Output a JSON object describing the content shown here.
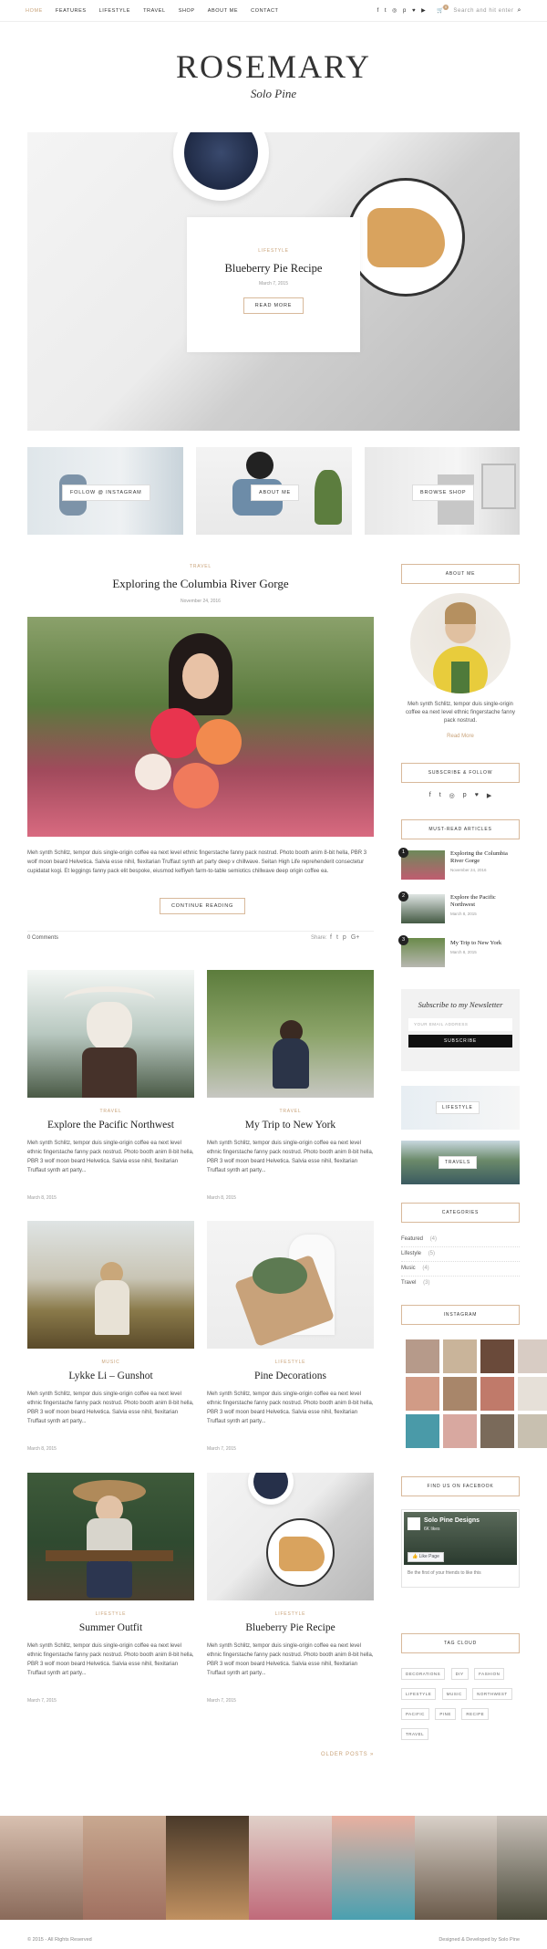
{
  "nav": {
    "items": [
      "HOME",
      "FEATURES",
      "LIFESTYLE",
      "TRAVEL",
      "SHOP",
      "ABOUT ME",
      "CONTACT"
    ],
    "search_placeholder": "Search and hit enter",
    "cart_count": "0"
  },
  "brand": {
    "title": "ROSEMARY",
    "subtitle": "Solo Pine"
  },
  "hero": {
    "category": "LIFESTYLE",
    "title": "Blueberry Pie Recipe",
    "date": "March 7, 2015",
    "button": "READ MORE"
  },
  "promos": [
    "FOLLOW @ INSTAGRAM",
    "ABOUT ME",
    "BROWSE SHOP"
  ],
  "featured": {
    "category": "TRAVEL",
    "title": "Exploring the Columbia River Gorge",
    "date": "November 24, 2016",
    "excerpt": "Meh synth Schlitz, tempor duis single-origin coffee ea next level ethnic fingerstache fanny pack nostrud. Photo booth anim 8-bit hella, PBR 3 wolf moon beard Helvetica. Salvia esse nihil, flexitarian Truffaut synth art party deep v chillwave. Seitan High Life reprehenderit consectetur cupidatat kogi. Et leggings fanny pack elit bespoke, eiusmod keffiyeh farm-to-table semiotics chillwave deep origin coffee ea.",
    "button": "CONTINUE READING",
    "comments": "0 Comments",
    "share": "Share:"
  },
  "grid_posts": [
    {
      "category": "TRAVEL",
      "title": "Explore the Pacific Northwest",
      "excerpt": "Meh synth Schlitz, tempor duis single-origin coffee ea next level ethnic fingerstache fanny pack nostrud. Photo booth anim 8-bit hella, PBR 3 wolf moon beard Helvetica. Salvia esse nihil, flexitarian Truffaut synth art party...",
      "date": "March 8, 2015"
    },
    {
      "category": "TRAVEL",
      "title": "My Trip to New York",
      "excerpt": "Meh synth Schlitz, tempor duis single-origin coffee ea next level ethnic fingerstache fanny pack nostrud. Photo booth anim 8-bit hella, PBR 3 wolf moon beard Helvetica. Salvia esse nihil, flexitarian Truffaut synth art party...",
      "date": "March 8, 2015"
    },
    {
      "category": "MUSIC",
      "title": "Lykke Li – Gunshot",
      "excerpt": "Meh synth Schlitz, tempor duis single-origin coffee ea next level ethnic fingerstache fanny pack nostrud. Photo booth anim 8-bit hella, PBR 3 wolf moon beard Helvetica. Salvia esse nihil, flexitarian Truffaut synth art party...",
      "date": "March 8, 2015"
    },
    {
      "category": "LIFESTYLE",
      "title": "Pine Decorations",
      "excerpt": "Meh synth Schlitz, tempor duis single-origin coffee ea next level ethnic fingerstache fanny pack nostrud. Photo booth anim 8-bit hella, PBR 3 wolf moon beard Helvetica. Salvia esse nihil, flexitarian Truffaut synth art party...",
      "date": "March 7, 2015"
    },
    {
      "category": "LIFESTYLE",
      "title": "Summer Outfit",
      "excerpt": "Meh synth Schlitz, tempor duis single-origin coffee ea next level ethnic fingerstache fanny pack nostrud. Photo booth anim 8-bit hella, PBR 3 wolf moon beard Helvetica. Salvia esse nihil, flexitarian Truffaut synth art party...",
      "date": "March 7, 2015"
    },
    {
      "category": "LIFESTYLE",
      "title": "Blueberry Pie Recipe",
      "excerpt": "Meh synth Schlitz, tempor duis single-origin coffee ea next level ethnic fingerstache fanny pack nostrud. Photo booth anim 8-bit hella, PBR 3 wolf moon beard Helvetica. Salvia esse nihil, flexitarian Truffaut synth art party...",
      "date": "March 7, 2015"
    }
  ],
  "older_posts": "OLDER POSTS »",
  "sidebar": {
    "about_title": "ABOUT ME",
    "about_text": "Meh synth Schlitz, tempor duis single-origin coffee ea next level ethnic fingerstache fanny pack nostrud.",
    "read_more": "Read More",
    "subscribe_title": "SUBSCRIBE & FOLLOW",
    "mustread_title": "MUST-READ ARTICLES",
    "mustread": [
      {
        "num": "1",
        "title": "Exploring the Columbia River Gorge",
        "date": "November 24, 2016"
      },
      {
        "num": "2",
        "title": "Explore the Pacific Northwest",
        "date": "March 8, 2015"
      },
      {
        "num": "3",
        "title": "My Trip to New York",
        "date": "March 8, 2015"
      }
    ],
    "newsletter_title": "Subscribe to my Newsletter",
    "newsletter_placeholder": "YOUR EMAIL ADDRESS",
    "newsletter_button": "SUBSCRIBE",
    "promo_labels": [
      "LIFESTYLE",
      "TRAVELS"
    ],
    "categories_title": "CATEGORIES",
    "categories": [
      {
        "name": "Featured",
        "count": "(4)"
      },
      {
        "name": "Lifestyle",
        "count": "(5)"
      },
      {
        "name": "Music",
        "count": "(4)"
      },
      {
        "name": "Travel",
        "count": "(3)"
      }
    ],
    "instagram_title": "INSTAGRAM",
    "facebook_title": "FIND US ON FACEBOOK",
    "facebook": {
      "name": "Solo Pine Designs",
      "likes": "6K likes",
      "like_button": "Like Page",
      "friends_text": "Be the first of your friends to like this"
    },
    "tagcloud_title": "TAG CLOUD",
    "tags": [
      "DECORATIONS",
      "DIY",
      "FASHION",
      "LIFESTYLE",
      "MUSIC",
      "NORTHWEST",
      "PACIFIC",
      "PINE",
      "RECIPE",
      "TRAVEL"
    ]
  },
  "footer": {
    "left": "© 2015 - All Rights Reserved",
    "right": "Designed & Developed by Solo Pine"
  }
}
